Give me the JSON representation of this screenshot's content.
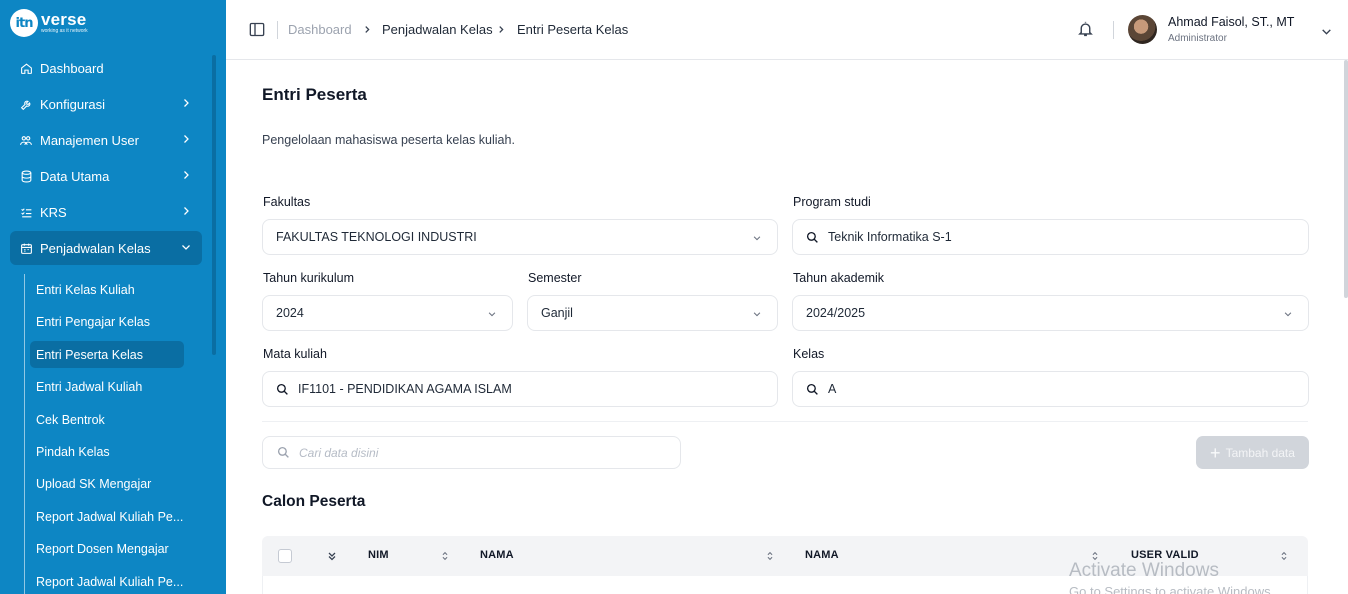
{
  "brand": {
    "logo_mark": "itn",
    "name": "verse",
    "tagline": "working as it network"
  },
  "sidebar": {
    "items": [
      {
        "label": "Dashboard",
        "icon": "home-icon"
      },
      {
        "label": "Konfigurasi",
        "icon": "wrench-icon"
      },
      {
        "label": "Manajemen User",
        "icon": "users-icon"
      },
      {
        "label": "Data Utama",
        "icon": "database-icon"
      },
      {
        "label": "KRS",
        "icon": "list-check-icon"
      },
      {
        "label": "Penjadwalan Kelas",
        "icon": "calendar-icon"
      }
    ],
    "subitems": [
      "Entri Kelas Kuliah",
      "Entri Pengajar Kelas",
      "Entri Peserta Kelas",
      "Entri Jadwal Kuliah",
      "Cek Bentrok",
      "Pindah Kelas",
      "Upload SK Mengajar",
      "Report Jadwal Kuliah Pe...",
      "Report Dosen Mengajar",
      "Report Jadwal Kuliah Pe..."
    ]
  },
  "header": {
    "breadcrumb": [
      "Dashboard",
      "Penjadwalan Kelas",
      "Entri Peserta Kelas"
    ],
    "user": {
      "name": "Ahmad Faisol, ST., MT",
      "role": "Administrator"
    }
  },
  "page": {
    "title": "Entri Peserta",
    "description": "Pengelolaan mahasiswa peserta kelas kuliah."
  },
  "form": {
    "fakultas": {
      "label": "Fakultas",
      "value": "FAKULTAS TEKNOLOGI INDUSTRI"
    },
    "program_studi": {
      "label": "Program studi",
      "value": "Teknik Informatika S-1"
    },
    "tahun_kurikulum": {
      "label": "Tahun kurikulum",
      "value": "2024"
    },
    "semester": {
      "label": "Semester",
      "value": "Ganjil"
    },
    "tahun_akademik": {
      "label": "Tahun akademik",
      "value": "2024/2025"
    },
    "mata_kuliah": {
      "label": "Mata kuliah",
      "value": "IF1101 - PENDIDIKAN AGAMA ISLAM"
    },
    "kelas": {
      "label": "Kelas",
      "value": "A"
    }
  },
  "toolbar": {
    "search_placeholder": "Cari data disini",
    "add_label": "Tambah data"
  },
  "section": {
    "title": "Calon Peserta"
  },
  "table": {
    "columns": [
      "NIM",
      "NAMA",
      "NAMA",
      "USER VALID"
    ]
  },
  "watermark": {
    "line1": "Activate Windows",
    "line2": "Go to Settings to activate Windows."
  },
  "colors": {
    "sidebar": "#0d86c4",
    "sidebar_active": "#0a6ea3",
    "button_disabled": "#d1d5db"
  }
}
